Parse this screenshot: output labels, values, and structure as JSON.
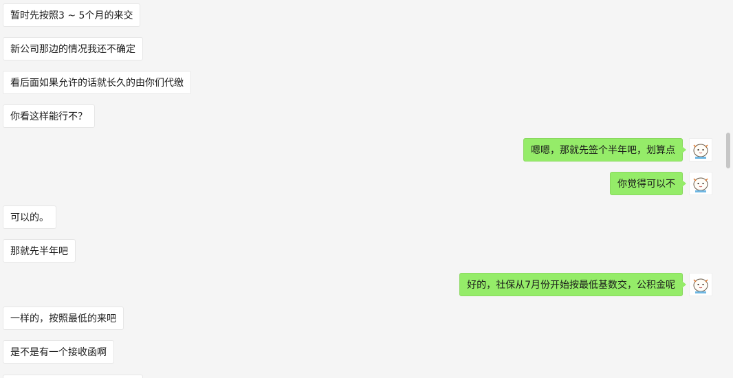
{
  "messages": [
    {
      "side": "left",
      "text": "暂时先按照3 ~ 5个月的来交"
    },
    {
      "side": "left",
      "text": "新公司那边的情况我还不确定"
    },
    {
      "side": "left",
      "text": "看后面如果允许的话就长久的由你们代缴"
    },
    {
      "side": "left",
      "text": "你看这样能行不？"
    },
    {
      "side": "right",
      "text": "嗯嗯，那就先签个半年吧，划算点"
    },
    {
      "side": "right",
      "text": "你觉得可以不"
    },
    {
      "side": "left",
      "text": "可以的。"
    },
    {
      "side": "left",
      "text": "那就先半年吧"
    },
    {
      "side": "right",
      "text": "好的，社保从7月份开始按最低基数交，公积金呢"
    },
    {
      "side": "left",
      "text": "一样的，按照最低的来吧"
    },
    {
      "side": "left",
      "text": "是不是有一个接收函啊"
    }
  ],
  "avatar": {
    "icon": "cartoon-avatar-icon"
  },
  "colors": {
    "background": "#f5f5f5",
    "incoming_bubble": "#ffffff",
    "outgoing_bubble": "#95ec69"
  }
}
